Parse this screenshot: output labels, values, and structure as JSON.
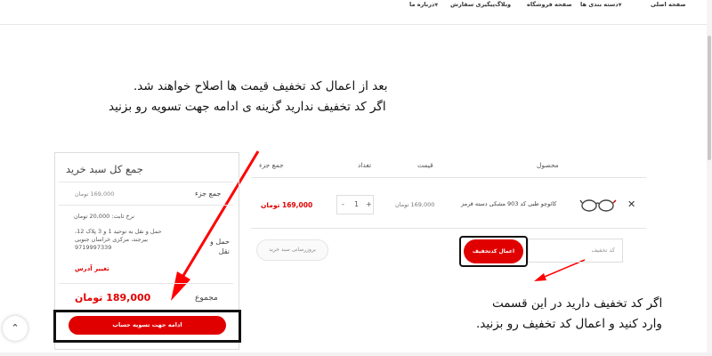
{
  "nav": {
    "items": [
      "صفحه اصلی",
      "دسته بندی ها",
      "صفحه فروشگاه",
      "وبلاگ",
      "پیگیری سفارش",
      "درباره ما"
    ]
  },
  "instructions": {
    "line1": "بعد از اعمال کد تخفیف قیمت ها اصلاح خواهند شد.",
    "line2": "اگر کد تخفیف ندارید  گزینه ی ادامه جهت تسویه رو بزنید"
  },
  "totals": {
    "title": "جمع کل سبد خرید",
    "subtotal_label": "جمع جزء",
    "subtotal_value": "169,000 تومان",
    "shipping_label": "حمل و نقل",
    "shipping_rate": "نرخ ثابت: 20,000 تومان",
    "shipping_address": "حمل و نقل به توحید 1 و 3 پلاک 12، بیرجند، مرکزی خراسان جنوبی 9719997339",
    "change_address": "تغییر آدرس",
    "total_label": "مجموع",
    "total_value": "189,000 تومان",
    "checkout_button": "ادامه جهت تسویه حساب"
  },
  "cart": {
    "headers": {
      "product": "محصول",
      "price": "قیمت",
      "quantity": "تعداد",
      "subtotal": "جمع جزء"
    },
    "items": [
      {
        "name": "کائوچو طبی کد 903  مشکی دسته قرمز",
        "price": "169,000 تومان",
        "quantity": "1",
        "subtotal": "169,000 تومان"
      }
    ],
    "update_button": "بروزرسانی سبد خرید",
    "coupon_placeholder": "کد تخفیف",
    "apply_button": "اعمال کدتخفیف"
  },
  "annotation": {
    "line1": "اگر کد تخفیف دارید در این قسمت",
    "line2": "وارد کنید و اعمال کد تخفیف رو بزنید."
  },
  "colors": {
    "accent": "#e00000",
    "annotation_arrow": "#ff0000"
  }
}
